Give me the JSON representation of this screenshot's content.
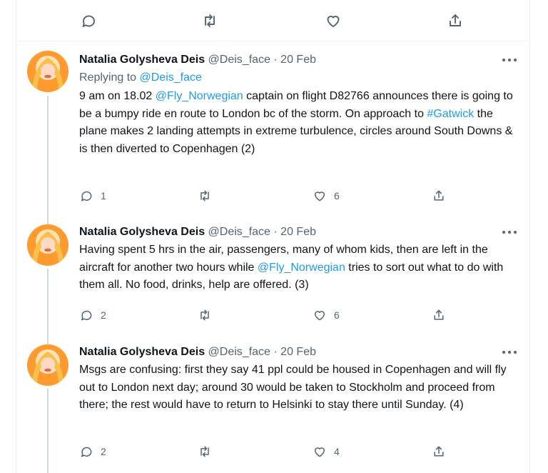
{
  "icons": {
    "reply": "reply-icon",
    "retweet": "retweet-icon",
    "like": "heart-icon",
    "share": "share-icon",
    "more": "more-icon"
  },
  "colors": {
    "link": "#1d9bf0",
    "secondary_text": "#536471",
    "primary_text": "#0f1419",
    "border": "#eff3f4"
  },
  "tweets": [
    {
      "name": "Natalia Golysheva Deis",
      "handle": "@Deis_face",
      "separator": "·",
      "date": "20 Feb",
      "replying_prefix": "Replying to ",
      "replying_handle": "@Deis_face",
      "text_parts": [
        "9 am on 18.02 ",
        "@Fly_Norwegian",
        " captain on flight D82766 announces there is going to be a bumpy ride en route to London bc of the storm. On approach to ",
        "#Gatwick",
        " the plane makes 2 landing attempts in extreme turbulence, circles around South Downs & is then diverted to Copenhagen (2)"
      ],
      "reply_count": "1",
      "retweet_count": "",
      "like_count": "6"
    },
    {
      "name": "Natalia Golysheva Deis",
      "handle": "@Deis_face",
      "separator": "·",
      "date": "20 Feb",
      "text_parts": [
        "Having spent 5 hrs in the air, passengers, many of whom kids, then are left in the aircraft for another two hours while ",
        "@Fly_Norwegian",
        " tries to sort out what to do with them all. No food, drinks, help are offered. (3)"
      ],
      "reply_count": "2",
      "retweet_count": "",
      "like_count": "6"
    },
    {
      "name": "Natalia Golysheva Deis",
      "handle": "@Deis_face",
      "separator": "·",
      "date": "20 Feb",
      "text": "Msgs are confusing: first they say 41 ppl could be housed in Copenhagen and will fly out to London next day; around 30 would be taken to Stockholm and proceed from there; the rest would have to return to Helsinki to stay there until Sunday. (4)",
      "reply_count": "2",
      "retweet_count": "",
      "like_count": "4"
    }
  ]
}
